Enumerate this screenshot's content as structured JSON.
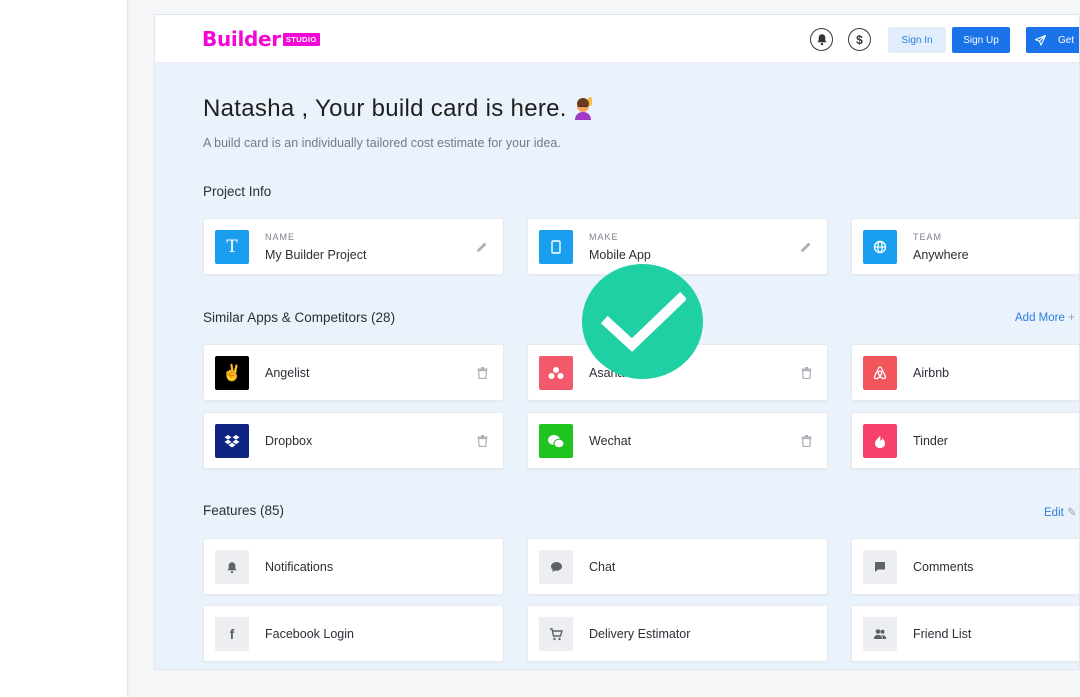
{
  "brand": {
    "name": "Builder",
    "badge": "STUDIO",
    "color": "#f208d6"
  },
  "topbar": {
    "notification_icon": "bell-icon",
    "currency_icon": "dollar-icon",
    "sign_in": "Sign In",
    "sign_up": "Sign Up",
    "get_label": "Get",
    "get_icon": "send-icon"
  },
  "header": {
    "title": "Natasha , Your build card is here.",
    "title_emoji": "raising-hand-emoji",
    "subtitle": "A build card is an individually tailored cost estimate for your idea."
  },
  "project_info": {
    "title": "Project Info",
    "items": [
      {
        "key": "NAME",
        "value": "My Builder Project",
        "icon": "text-T-icon",
        "color": "#1a9ef0",
        "action": "edit-icon"
      },
      {
        "key": "MAKE",
        "value": "Mobile App",
        "icon": "mobile-icon",
        "color": "#1a9ef0",
        "action": "edit-icon"
      },
      {
        "key": "TEAM",
        "value": "Anywhere",
        "icon": "globe-icon",
        "color": "#1a9ef0"
      }
    ]
  },
  "competitors": {
    "title": "Similar Apps & Competitors (28)",
    "add_more": "Add More",
    "items": [
      {
        "name": "Angelist",
        "icon": "angelist-icon",
        "color": "#000000"
      },
      {
        "name": "Asana",
        "icon": "asana-icon",
        "color": "#f25a6b"
      },
      {
        "name": "Airbnb",
        "icon": "airbnb-icon",
        "color": "#f2555b"
      },
      {
        "name": "Dropbox",
        "icon": "dropbox-icon",
        "color": "#0d2481"
      },
      {
        "name": "Wechat",
        "icon": "wechat-icon",
        "color": "#1fc41e"
      },
      {
        "name": "Tinder",
        "icon": "tinder-icon",
        "color": "#f7406b"
      }
    ]
  },
  "features": {
    "title": "Features (85)",
    "edit": "Edit",
    "items": [
      {
        "name": "Notifications",
        "icon": "bell-icon"
      },
      {
        "name": "Chat",
        "icon": "chat-bubble-icon"
      },
      {
        "name": "Comments",
        "icon": "comment-icon"
      },
      {
        "name": "Facebook Login",
        "icon": "facebook-icon"
      },
      {
        "name": "Delivery Estimator",
        "icon": "cart-icon"
      },
      {
        "name": "Friend List",
        "icon": "friends-icon"
      }
    ]
  },
  "overlay": {
    "icon": "checkmark-icon",
    "color": "#1ed0a3"
  }
}
